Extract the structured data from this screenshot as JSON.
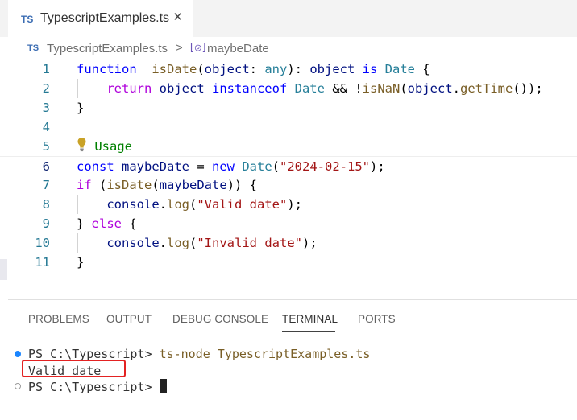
{
  "tab": {
    "badge": "TS",
    "title": "TypescriptExamples.ts",
    "close_glyph": "×"
  },
  "breadcrumb": {
    "badge": "TS",
    "file": "TypescriptExamples.ts",
    "separator": ">",
    "symbol_icon": "[◎]",
    "symbol": "maybeDate"
  },
  "code_lines": [
    {
      "n": "1",
      "tokens": [
        [
          "k",
          "function"
        ],
        [
          "",
          "  "
        ],
        [
          "f",
          "isDate"
        ],
        [
          "",
          "("
        ],
        [
          "v",
          "object"
        ],
        [
          "",
          ": "
        ],
        [
          "t",
          "any"
        ],
        [
          "",
          "): "
        ],
        [
          "v",
          "object"
        ],
        [
          "",
          ""
        ],
        [
          "k",
          " is"
        ],
        [
          "",
          ""
        ],
        [
          "t",
          " Date"
        ],
        [
          "",
          " {"
        ]
      ]
    },
    {
      "n": "2",
      "tokens": [
        [
          "",
          "    "
        ],
        [
          "c",
          "return"
        ],
        [
          "",
          ""
        ],
        [
          "v",
          " object"
        ],
        [
          "",
          ""
        ],
        [
          "k",
          " instanceof"
        ],
        [
          "",
          ""
        ],
        [
          "t",
          " Date"
        ],
        [
          "",
          " && !"
        ],
        [
          "f",
          "isNaN"
        ],
        [
          "",
          "("
        ],
        [
          "v",
          "object"
        ],
        [
          "",
          "."
        ],
        [
          "f",
          "getTime"
        ],
        [
          "",
          "());"
        ]
      ]
    },
    {
      "n": "3",
      "tokens": [
        [
          "",
          "}"
        ]
      ]
    },
    {
      "n": "4",
      "tokens": []
    },
    {
      "n": "5",
      "tokens": [
        [
          "cm",
          "// Usage"
        ]
      ]
    },
    {
      "n": "6",
      "tokens": [
        [
          "k",
          "const"
        ],
        [
          "",
          ""
        ],
        [
          "v",
          " maybeDate"
        ],
        [
          "",
          " = "
        ],
        [
          "k",
          "new"
        ],
        [
          "",
          ""
        ],
        [
          "t",
          " Date"
        ],
        [
          "",
          "("
        ],
        [
          "s",
          "\"2024-02-15\""
        ],
        [
          "",
          ");"
        ]
      ]
    },
    {
      "n": "7",
      "tokens": [
        [
          "c",
          "if"
        ],
        [
          "",
          " ("
        ],
        [
          "f",
          "isDate"
        ],
        [
          "",
          "("
        ],
        [
          "v",
          "maybeDate"
        ],
        [
          "",
          ")) {"
        ]
      ]
    },
    {
      "n": "8",
      "tokens": [
        [
          "",
          "    "
        ],
        [
          "v",
          "console"
        ],
        [
          "",
          "."
        ],
        [
          "f",
          "log"
        ],
        [
          "",
          "("
        ],
        [
          "s",
          "\"Valid date\""
        ],
        [
          "",
          ");"
        ]
      ]
    },
    {
      "n": "9",
      "tokens": [
        [
          "",
          "} "
        ],
        [
          "c",
          "else"
        ],
        [
          "",
          " {"
        ]
      ]
    },
    {
      "n": "10",
      "tokens": [
        [
          "",
          "    "
        ],
        [
          "v",
          "console"
        ],
        [
          "",
          "."
        ],
        [
          "f",
          "log"
        ],
        [
          "",
          "("
        ],
        [
          "s",
          "\"Invalid date\""
        ],
        [
          "",
          ");"
        ]
      ]
    },
    {
      "n": "11",
      "tokens": [
        [
          "",
          "}"
        ]
      ]
    }
  ],
  "panel": {
    "tabs": [
      "PROBLEMS",
      "OUTPUT",
      "DEBUG CONSOLE",
      "TERMINAL",
      "PORTS"
    ],
    "active_tab": "TERMINAL"
  },
  "terminal": {
    "prompt1": "PS C:\\Typescript> ",
    "command": "ts-node TypescriptExamples.ts",
    "output": "Valid date",
    "prompt2": "PS C:\\Typescript> "
  },
  "colors": {
    "keyword": "#0000ff",
    "control": "#af00db",
    "function": "#795e26",
    "variable": "#001080",
    "type": "#267f99",
    "string": "#a31515",
    "comment": "#008000",
    "highlight_box": "#e32222"
  },
  "icons": {
    "lightbulb": "lightbulb-icon",
    "close": "close-icon",
    "symbol": "symbol-variable-icon"
  }
}
